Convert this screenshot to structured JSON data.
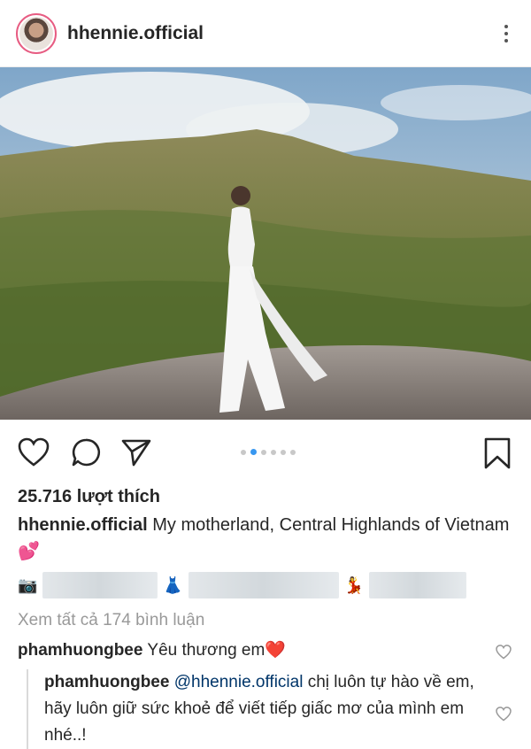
{
  "post": {
    "username": "hhennie.official",
    "likes": "25.716 lượt thích",
    "caption_user": "hhennie.official",
    "caption_text": "My motherland, Central Highlands of Vietnam 💕",
    "view_all": "Xem tất cả 174 bình luận"
  },
  "tags_row": {
    "emoji_1": "📷",
    "emoji_2": "👗",
    "emoji_3": "💃"
  },
  "carousel": {
    "count": 6,
    "active_index": 1
  },
  "comments": [
    {
      "user": "phamhuongbee",
      "text": "Yêu thương em❤️"
    }
  ],
  "reply": {
    "user": "phamhuongbee",
    "mention": "@hhennie.official",
    "text": " chị luôn tự hào về em, hãy luôn giữ sức khoẻ để viết tiếp giấc mơ của mình em nhé..!"
  },
  "colors": {
    "accent_blue": "#3897f0",
    "heart_red": "#e0245e",
    "text": "#262626"
  }
}
